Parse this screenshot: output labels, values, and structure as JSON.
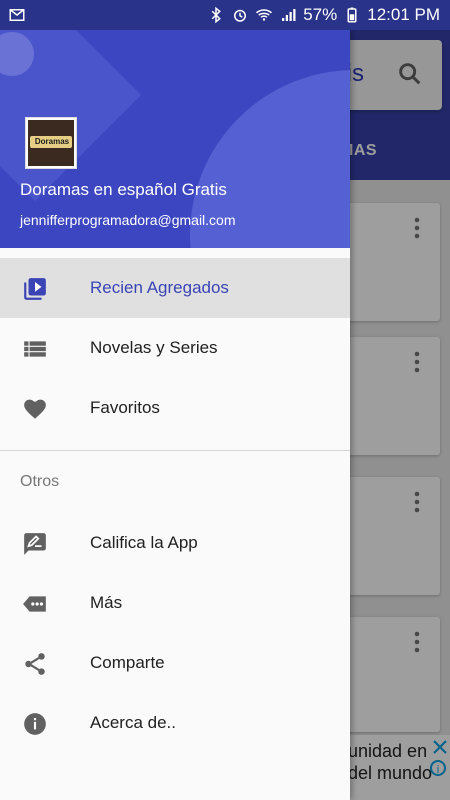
{
  "status_bar": {
    "battery": "57%",
    "time": "12:01 PM",
    "icons": [
      "mail-icon",
      "bluetooth-icon",
      "alarm-icon",
      "wifi-icon",
      "signal-icon",
      "battery-icon"
    ]
  },
  "main_screen": {
    "search_text": "tis",
    "tab_text": "MAS",
    "ad": {
      "line1": "unidad en",
      "line2": "del mundo"
    }
  },
  "drawer": {
    "header": {
      "app_name": "Doramas en español Gratis",
      "email": "jennifferprogramadora@gmail.com",
      "avatar_text": "Doramas"
    },
    "items": [
      {
        "label": "Recien Agregados",
        "icon": "play-library-icon",
        "active": true
      },
      {
        "label": "Novelas y Series",
        "icon": "list-icon",
        "active": false
      },
      {
        "label": "Favoritos",
        "icon": "heart-icon",
        "active": false
      }
    ],
    "section_title": "Otros",
    "other_items": [
      {
        "label": "Califica la App",
        "icon": "rate-review-icon"
      },
      {
        "label": "Más",
        "icon": "more-label-icon"
      },
      {
        "label": "Comparte",
        "icon": "share-icon"
      },
      {
        "label": "Acerca de..",
        "icon": "info-icon"
      }
    ]
  },
  "colors": {
    "primary": "#3c46c0",
    "accent_text": "#3a44b5",
    "icon_gray": "#616161"
  }
}
